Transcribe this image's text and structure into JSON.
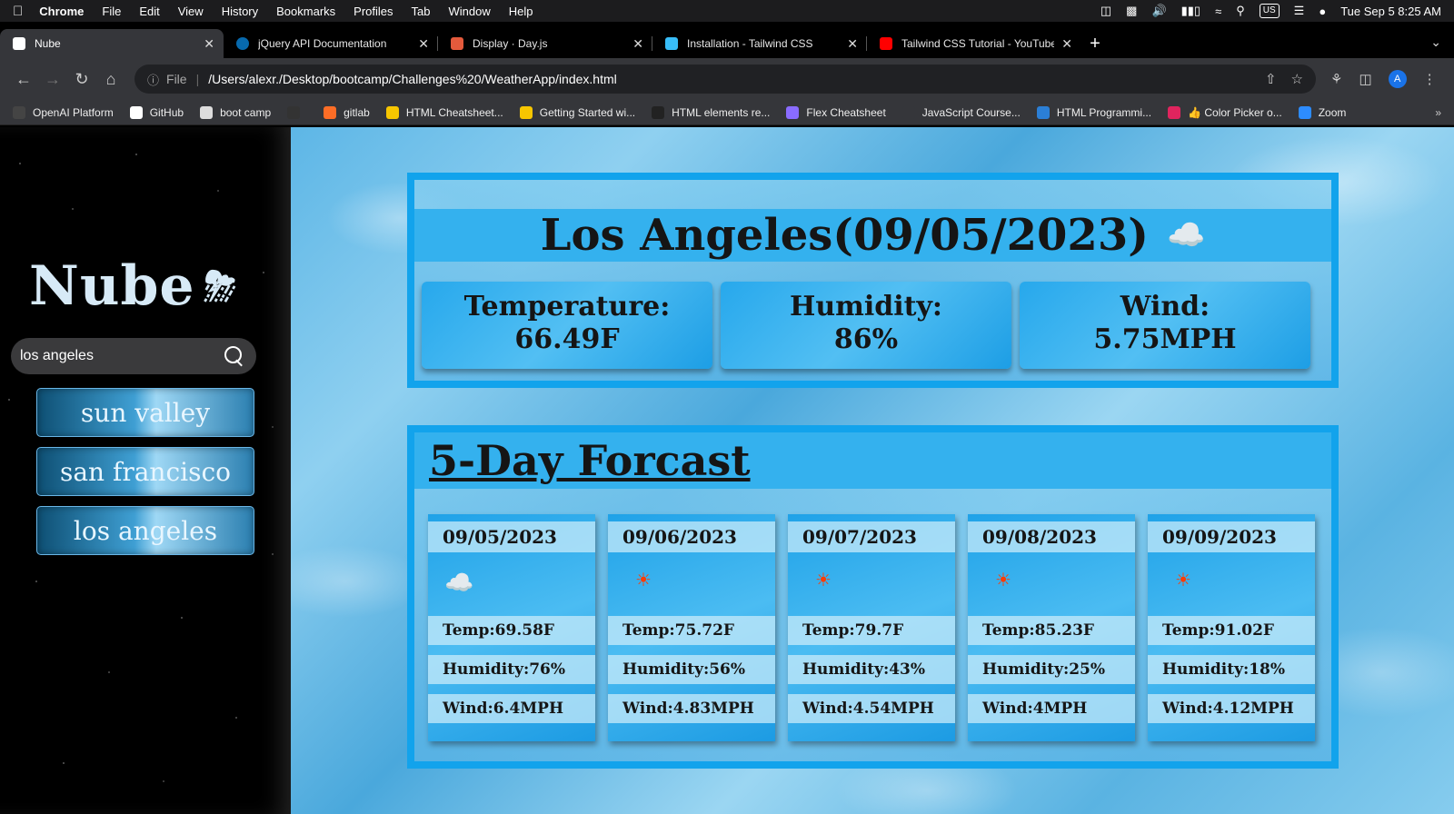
{
  "menubar": {
    "app": "Chrome",
    "items": [
      "File",
      "Edit",
      "View",
      "History",
      "Bookmarks",
      "Profiles",
      "Tab",
      "Window",
      "Help"
    ],
    "input_source": "US",
    "datetime": "Tue Sep 5  8:25 AM"
  },
  "tabs": [
    {
      "title": "Nube",
      "favicon_color": "#ffffff",
      "active": true
    },
    {
      "title": "jQuery API Documentation",
      "favicon_color": "#0769ad"
    },
    {
      "title": "Display · Day.js",
      "favicon_color": "#e45a3c"
    },
    {
      "title": "Installation - Tailwind CSS",
      "favicon_color": "#38bdf8"
    },
    {
      "title": "Tailwind CSS Tutorial - YouTube",
      "favicon_color": "#ff0000"
    }
  ],
  "address": {
    "scheme": "File",
    "url": "/Users/alexr./Desktop/bootcamp/Challenges%20/WeatherApp/index.html",
    "profile_initial": "A"
  },
  "bookmarks": [
    {
      "label": "OpenAI Platform",
      "color": "#444444"
    },
    {
      "label": "GitHub",
      "color": "#ffffff"
    },
    {
      "label": "boot camp",
      "color": "#dddddd"
    },
    {
      "label": "",
      "color": "#333333"
    },
    {
      "label": "gitlab",
      "color": "#fc6d26"
    },
    {
      "label": "HTML Cheatsheet...",
      "color": "#f7c600"
    },
    {
      "label": "Getting Started wi...",
      "color": "#f7c600"
    },
    {
      "label": "HTML elements re...",
      "color": "#222222"
    },
    {
      "label": "Flex Cheatsheet",
      "color": "#8a6cff"
    },
    {
      "label": "JavaScript Course...",
      "color": "#35363a"
    },
    {
      "label": "HTML Programmi...",
      "color": "#2b7fd6"
    },
    {
      "label": "👍 Color Picker o...",
      "color": "#e0245e"
    },
    {
      "label": "Zoom",
      "color": "#2d8cff"
    }
  ],
  "app": {
    "logo": "Nube",
    "search_value": "los angeles",
    "history": [
      "sun valley",
      "san francisco",
      "los angeles"
    ],
    "current": {
      "title": "Los Angeles(09/05/2023)",
      "temperature_label": "Temperature:",
      "temperature": "66.49F",
      "humidity_label": "Humidity:",
      "humidity": "86%",
      "wind_label": "Wind:",
      "wind": "5.75MPH",
      "icon": "cloud-icon"
    },
    "forecast_title": "5-Day Forcast",
    "forecast": [
      {
        "date": "09/05/2023",
        "icon": "cloud-icon",
        "temp": "Temp:69.58F",
        "humidity": "Humidity:76%",
        "wind": "Wind:6.4MPH"
      },
      {
        "date": "09/06/2023",
        "icon": "sun-icon",
        "temp": "Temp:75.72F",
        "humidity": "Humidity:56%",
        "wind": "Wind:4.83MPH"
      },
      {
        "date": "09/07/2023",
        "icon": "sun-icon",
        "temp": "Temp:79.7F",
        "humidity": "Humidity:43%",
        "wind": "Wind:4.54MPH"
      },
      {
        "date": "09/08/2023",
        "icon": "sun-icon",
        "temp": "Temp:85.23F",
        "humidity": "Humidity:25%",
        "wind": "Wind:4MPH"
      },
      {
        "date": "09/09/2023",
        "icon": "sun-icon",
        "temp": "Temp:91.02F",
        "humidity": "Humidity:18%",
        "wind": "Wind:4.12MPH"
      }
    ]
  }
}
